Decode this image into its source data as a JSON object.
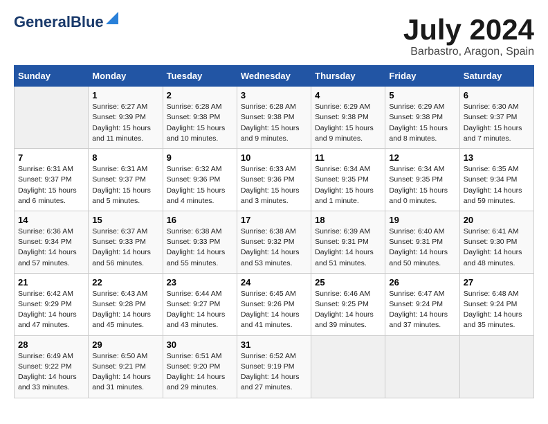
{
  "header": {
    "logo_general": "General",
    "logo_blue": "Blue",
    "title": "July 2024",
    "location": "Barbastro, Aragon, Spain"
  },
  "calendar": {
    "days_of_week": [
      "Sunday",
      "Monday",
      "Tuesday",
      "Wednesday",
      "Thursday",
      "Friday",
      "Saturday"
    ],
    "weeks": [
      [
        {
          "day": "",
          "sunrise": "",
          "sunset": "",
          "daylight": ""
        },
        {
          "day": "1",
          "sunrise": "Sunrise: 6:27 AM",
          "sunset": "Sunset: 9:39 PM",
          "daylight": "Daylight: 15 hours and 11 minutes."
        },
        {
          "day": "2",
          "sunrise": "Sunrise: 6:28 AM",
          "sunset": "Sunset: 9:38 PM",
          "daylight": "Daylight: 15 hours and 10 minutes."
        },
        {
          "day": "3",
          "sunrise": "Sunrise: 6:28 AM",
          "sunset": "Sunset: 9:38 PM",
          "daylight": "Daylight: 15 hours and 9 minutes."
        },
        {
          "day": "4",
          "sunrise": "Sunrise: 6:29 AM",
          "sunset": "Sunset: 9:38 PM",
          "daylight": "Daylight: 15 hours and 9 minutes."
        },
        {
          "day": "5",
          "sunrise": "Sunrise: 6:29 AM",
          "sunset": "Sunset: 9:38 PM",
          "daylight": "Daylight: 15 hours and 8 minutes."
        },
        {
          "day": "6",
          "sunrise": "Sunrise: 6:30 AM",
          "sunset": "Sunset: 9:37 PM",
          "daylight": "Daylight: 15 hours and 7 minutes."
        }
      ],
      [
        {
          "day": "7",
          "sunrise": "Sunrise: 6:31 AM",
          "sunset": "Sunset: 9:37 PM",
          "daylight": "Daylight: 15 hours and 6 minutes."
        },
        {
          "day": "8",
          "sunrise": "Sunrise: 6:31 AM",
          "sunset": "Sunset: 9:37 PM",
          "daylight": "Daylight: 15 hours and 5 minutes."
        },
        {
          "day": "9",
          "sunrise": "Sunrise: 6:32 AM",
          "sunset": "Sunset: 9:36 PM",
          "daylight": "Daylight: 15 hours and 4 minutes."
        },
        {
          "day": "10",
          "sunrise": "Sunrise: 6:33 AM",
          "sunset": "Sunset: 9:36 PM",
          "daylight": "Daylight: 15 hours and 3 minutes."
        },
        {
          "day": "11",
          "sunrise": "Sunrise: 6:34 AM",
          "sunset": "Sunset: 9:35 PM",
          "daylight": "Daylight: 15 hours and 1 minute."
        },
        {
          "day": "12",
          "sunrise": "Sunrise: 6:34 AM",
          "sunset": "Sunset: 9:35 PM",
          "daylight": "Daylight: 15 hours and 0 minutes."
        },
        {
          "day": "13",
          "sunrise": "Sunrise: 6:35 AM",
          "sunset": "Sunset: 9:34 PM",
          "daylight": "Daylight: 14 hours and 59 minutes."
        }
      ],
      [
        {
          "day": "14",
          "sunrise": "Sunrise: 6:36 AM",
          "sunset": "Sunset: 9:34 PM",
          "daylight": "Daylight: 14 hours and 57 minutes."
        },
        {
          "day": "15",
          "sunrise": "Sunrise: 6:37 AM",
          "sunset": "Sunset: 9:33 PM",
          "daylight": "Daylight: 14 hours and 56 minutes."
        },
        {
          "day": "16",
          "sunrise": "Sunrise: 6:38 AM",
          "sunset": "Sunset: 9:33 PM",
          "daylight": "Daylight: 14 hours and 55 minutes."
        },
        {
          "day": "17",
          "sunrise": "Sunrise: 6:38 AM",
          "sunset": "Sunset: 9:32 PM",
          "daylight": "Daylight: 14 hours and 53 minutes."
        },
        {
          "day": "18",
          "sunrise": "Sunrise: 6:39 AM",
          "sunset": "Sunset: 9:31 PM",
          "daylight": "Daylight: 14 hours and 51 minutes."
        },
        {
          "day": "19",
          "sunrise": "Sunrise: 6:40 AM",
          "sunset": "Sunset: 9:31 PM",
          "daylight": "Daylight: 14 hours and 50 minutes."
        },
        {
          "day": "20",
          "sunrise": "Sunrise: 6:41 AM",
          "sunset": "Sunset: 9:30 PM",
          "daylight": "Daylight: 14 hours and 48 minutes."
        }
      ],
      [
        {
          "day": "21",
          "sunrise": "Sunrise: 6:42 AM",
          "sunset": "Sunset: 9:29 PM",
          "daylight": "Daylight: 14 hours and 47 minutes."
        },
        {
          "day": "22",
          "sunrise": "Sunrise: 6:43 AM",
          "sunset": "Sunset: 9:28 PM",
          "daylight": "Daylight: 14 hours and 45 minutes."
        },
        {
          "day": "23",
          "sunrise": "Sunrise: 6:44 AM",
          "sunset": "Sunset: 9:27 PM",
          "daylight": "Daylight: 14 hours and 43 minutes."
        },
        {
          "day": "24",
          "sunrise": "Sunrise: 6:45 AM",
          "sunset": "Sunset: 9:26 PM",
          "daylight": "Daylight: 14 hours and 41 minutes."
        },
        {
          "day": "25",
          "sunrise": "Sunrise: 6:46 AM",
          "sunset": "Sunset: 9:25 PM",
          "daylight": "Daylight: 14 hours and 39 minutes."
        },
        {
          "day": "26",
          "sunrise": "Sunrise: 6:47 AM",
          "sunset": "Sunset: 9:24 PM",
          "daylight": "Daylight: 14 hours and 37 minutes."
        },
        {
          "day": "27",
          "sunrise": "Sunrise: 6:48 AM",
          "sunset": "Sunset: 9:24 PM",
          "daylight": "Daylight: 14 hours and 35 minutes."
        }
      ],
      [
        {
          "day": "28",
          "sunrise": "Sunrise: 6:49 AM",
          "sunset": "Sunset: 9:22 PM",
          "daylight": "Daylight: 14 hours and 33 minutes."
        },
        {
          "day": "29",
          "sunrise": "Sunrise: 6:50 AM",
          "sunset": "Sunset: 9:21 PM",
          "daylight": "Daylight: 14 hours and 31 minutes."
        },
        {
          "day": "30",
          "sunrise": "Sunrise: 6:51 AM",
          "sunset": "Sunset: 9:20 PM",
          "daylight": "Daylight: 14 hours and 29 minutes."
        },
        {
          "day": "31",
          "sunrise": "Sunrise: 6:52 AM",
          "sunset": "Sunset: 9:19 PM",
          "daylight": "Daylight: 14 hours and 27 minutes."
        },
        {
          "day": "",
          "sunrise": "",
          "sunset": "",
          "daylight": ""
        },
        {
          "day": "",
          "sunrise": "",
          "sunset": "",
          "daylight": ""
        },
        {
          "day": "",
          "sunrise": "",
          "sunset": "",
          "daylight": ""
        }
      ]
    ]
  }
}
